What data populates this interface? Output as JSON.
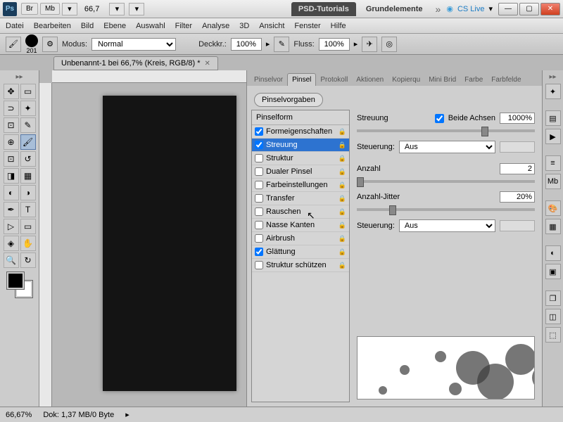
{
  "titlebar": {
    "br": "Br",
    "mb": "Mb",
    "zoom": "66,7",
    "tab_dark": "PSD-Tutorials",
    "tab_light": "Grundelemente",
    "cs_live": "CS Live"
  },
  "menu": [
    "Datei",
    "Bearbeiten",
    "Bild",
    "Ebene",
    "Auswahl",
    "Filter",
    "Analyse",
    "3D",
    "Ansicht",
    "Fenster",
    "Hilfe"
  ],
  "options": {
    "brush_size": "201",
    "mode_label": "Modus:",
    "mode_value": "Normal",
    "opacity_label": "Deckkr.:",
    "opacity_value": "100%",
    "flow_label": "Fluss:",
    "flow_value": "100%"
  },
  "doc_tab": "Unbenannt-1 bei 66,7% (Kreis, RGB/8) *",
  "panel": {
    "tabs": [
      "Pinselvor",
      "Pinsel",
      "Protokoll",
      "Aktionen",
      "Kopierqu",
      "Mini Brid",
      "Farbe",
      "Farbfelde"
    ],
    "active_tab": 1,
    "presets_btn": "Pinselvorgaben",
    "shape_header": "Pinselform",
    "shape_items": [
      {
        "label": "Formeigenschaften",
        "checked": true,
        "sel": false
      },
      {
        "label": "Streuung",
        "checked": true,
        "sel": true
      },
      {
        "label": "Struktur",
        "checked": false,
        "sel": false
      },
      {
        "label": "Dualer Pinsel",
        "checked": false,
        "sel": false
      },
      {
        "label": "Farbeinstellungen",
        "checked": false,
        "sel": false
      },
      {
        "label": "Transfer",
        "checked": false,
        "sel": false
      },
      {
        "label": "Rauschen",
        "checked": false,
        "sel": false
      },
      {
        "label": "Nasse Kanten",
        "checked": false,
        "sel": false
      },
      {
        "label": "Airbrush",
        "checked": false,
        "sel": false
      },
      {
        "label": "Glättung",
        "checked": true,
        "sel": false
      },
      {
        "label": "Struktur schützen",
        "checked": false,
        "sel": false
      }
    ],
    "scatter_label": "Streuung",
    "both_axes": "Beide Achsen",
    "both_axes_checked": true,
    "scatter_value": "1000%",
    "control_label": "Steuerung:",
    "control_value": "Aus",
    "count_label": "Anzahl",
    "count_value": "2",
    "count_jitter_label": "Anzahl-Jitter",
    "count_jitter_value": "20%",
    "control2_value": "Aus"
  },
  "status": {
    "zoom": "66,67%",
    "doc": "Dok: 1,37 MB/0 Byte"
  }
}
